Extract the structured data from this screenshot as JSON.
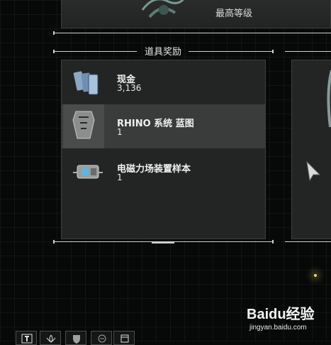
{
  "top_card": {
    "level_text": "最高等级"
  },
  "section": {
    "title": "道具奖励"
  },
  "rewards": [
    {
      "name": "现金",
      "qty": "3,136",
      "icon": "cash-icon",
      "selected": false
    },
    {
      "name": "RHINO 系统 蓝图",
      "qty": "1",
      "icon": "blueprint-icon",
      "selected": true
    },
    {
      "name": "电磁力场装置样本",
      "qty": "1",
      "icon": "field-device-icon",
      "selected": false
    }
  ],
  "toolbar": {
    "buttons": [
      "text-icon",
      "lotus-icon",
      "shield-icon",
      "helmet-icon",
      "panel-icon"
    ]
  },
  "watermark": {
    "logo": "Baidu经验",
    "url": "jingyan.baidu.com"
  },
  "colors": {
    "background": "#070909",
    "panel": "#232525",
    "selected_row": "#3a3c3c",
    "text": "#f0f0f0"
  }
}
